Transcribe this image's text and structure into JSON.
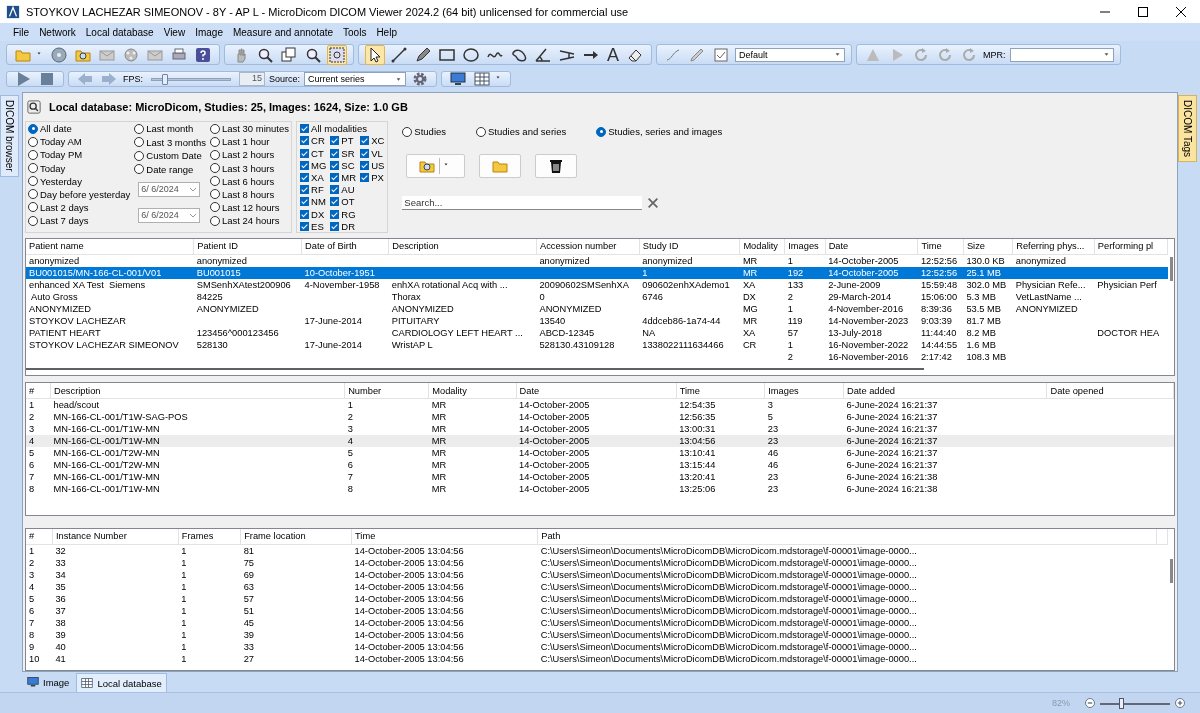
{
  "window": {
    "title": "STOYKOV LACHEZAR SIMEONOV - 8Y - AP L - MicroDicom DICOM Viewer 2024.2 (64 bit) unlicensed for commercial use"
  },
  "menu": [
    "File",
    "Network",
    "Local database",
    "View",
    "Image",
    "Measure and annotate",
    "Tools",
    "Help"
  ],
  "toolbar": {
    "text_tool": "A",
    "preset": "Default",
    "mpr_label": "MPR:",
    "fps": {
      "label": "FPS:",
      "level": 0.18,
      "value": "15"
    },
    "source": {
      "label": "Source:",
      "value": "Current series"
    }
  },
  "side_tabs": {
    "left": "DICOM browser",
    "right": "DICOM Tags"
  },
  "header": "Local database: MicroDicom, Studies: 25, Images: 1624, Size: 1.0 GB",
  "date_filters": [
    {
      "items": [
        {
          "kind": "radio",
          "label": "All date",
          "selected": true
        },
        {
          "kind": "radio",
          "label": "Today AM",
          "selected": false
        },
        {
          "kind": "radio",
          "label": "Today PM",
          "selected": false
        },
        {
          "kind": "radio",
          "label": "Today",
          "selected": false
        },
        {
          "kind": "radio",
          "label": "Yesterday",
          "selected": false
        },
        {
          "kind": "radio",
          "label": "Day before yesterday",
          "selected": false
        },
        {
          "kind": "radio",
          "label": "Last 2 days",
          "selected": false
        },
        {
          "kind": "radio",
          "label": "Last 7 days",
          "selected": false
        }
      ]
    },
    {
      "items": [
        {
          "kind": "radio",
          "label": "Last month",
          "selected": false
        },
        {
          "kind": "radio",
          "label": "Last 3 months",
          "selected": false
        },
        {
          "kind": "radio",
          "label": "Custom Date",
          "selected": false
        },
        {
          "kind": "radio",
          "label": "Date range",
          "selected": false
        },
        {
          "kind": "date",
          "value": "6/ 6/2024"
        },
        {
          "kind": "date",
          "value": "6/ 6/2024"
        }
      ]
    },
    {
      "items": [
        {
          "kind": "radio",
          "label": "Last 30 minutes",
          "selected": false
        },
        {
          "kind": "radio",
          "label": "Last 1 hour",
          "selected": false
        },
        {
          "kind": "radio",
          "label": "Last 2 hours",
          "selected": false
        },
        {
          "kind": "radio",
          "label": "Last 3 hours",
          "selected": false
        },
        {
          "kind": "radio",
          "label": "Last 6 hours",
          "selected": false
        },
        {
          "kind": "radio",
          "label": "Last 8 hours",
          "selected": false
        },
        {
          "kind": "radio",
          "label": "Last 12 hours",
          "selected": false
        },
        {
          "kind": "radio",
          "label": "Last 24 hours",
          "selected": false
        }
      ]
    }
  ],
  "modalities": {
    "all": {
      "label": "All modalities",
      "checked": true
    },
    "items": [
      {
        "label": "CR",
        "checked": true
      },
      {
        "label": "CT",
        "checked": true
      },
      {
        "label": "MG",
        "checked": true
      },
      {
        "label": "XA",
        "checked": true
      },
      {
        "label": "RF",
        "checked": true
      },
      {
        "label": "NM",
        "checked": true
      },
      {
        "label": "DX",
        "checked": true
      },
      {
        "label": "ES",
        "checked": true
      },
      {
        "label": "PT",
        "checked": true
      },
      {
        "label": "SR",
        "checked": true
      },
      {
        "label": "SC",
        "checked": true
      },
      {
        "label": "MR",
        "checked": true
      },
      {
        "label": "AU",
        "checked": true
      },
      {
        "label": "OT",
        "checked": true
      },
      {
        "label": "RG",
        "checked": true
      },
      {
        "label": "DR",
        "checked": true
      },
      {
        "label": "XC",
        "checked": true
      },
      {
        "label": "VL",
        "checked": true
      },
      {
        "label": "US",
        "checked": true
      },
      {
        "label": "PX",
        "checked": true
      }
    ]
  },
  "view_modes": [
    {
      "label": "Studies",
      "selected": false
    },
    {
      "label": "Studies and series",
      "selected": false
    },
    {
      "label": "Studies, series and images",
      "selected": true
    }
  ],
  "search": {
    "placeholder": "Search..."
  },
  "studies": {
    "columns": [
      "Patient name",
      "Patient ID",
      "Date of Birth",
      "Description",
      "Accession number",
      "Study ID",
      "Modality",
      "Images",
      "Date",
      "Time",
      "Size",
      "Referring phys...",
      "Performing pl"
    ],
    "rows": [
      {
        "selected": false,
        "cells": [
          "anonymized",
          "anonymized",
          null,
          null,
          "anonymized",
          "anonymized",
          "MR",
          "1",
          "14-October-2005",
          "12:52:56",
          "130.0 KB",
          "anonymized",
          null
        ]
      },
      {
        "selected": true,
        "cells": [
          "BU001015/MN-166-CL-001/V01",
          "BU001015",
          "10-October-1951",
          null,
          null,
          "1",
          "MR",
          "192",
          "14-October-2005",
          "12:52:56",
          "25.1 MB",
          null,
          null
        ]
      },
      {
        "selected": false,
        "cells": [
          "enhanced XA Test  Siemens",
          "SMSenhXAtest200906",
          "4-November-1958",
          "enhXA rotational Acq with ...",
          "20090602SMSenhXA",
          "090602enhXAdemo1",
          "XA",
          "133",
          "2-June-2009",
          "15:59:48",
          "302.0 MB",
          "Physician Refe...",
          "Physician Perf"
        ]
      },
      {
        "selected": false,
        "cells": [
          " Auto Gross",
          "84225",
          null,
          "Thorax",
          "0",
          "6746",
          "DX",
          "2",
          "29-March-2014",
          "15:06:00",
          "5.3 MB",
          "VetLastName ...",
          null
        ]
      },
      {
        "selected": false,
        "cells": [
          "ANONYMIZED",
          "ANONYMIZED",
          null,
          "ANONYMIZED",
          "ANONYMIZED",
          null,
          "MG",
          "1",
          "4-November-2016",
          "8:39:36",
          "53.5 MB",
          "ANONYMIZED",
          null
        ]
      },
      {
        "selected": false,
        "cells": [
          "STOYKOV LACHEZAR",
          null,
          "17-June-2014",
          "PITUITARY",
          "13540",
          "4ddceb86-1a74-44",
          "MR",
          "119",
          "14-November-2023",
          "9:03:39",
          "81.7 MB",
          null,
          null
        ]
      },
      {
        "selected": false,
        "cells": [
          "PATIENT HEART",
          "123456^000123456",
          null,
          "CARDIOLOGY LEFT HEART ...",
          "ABCD-12345",
          "NA",
          "XA",
          "57",
          "13-July-2018",
          "11:44:40",
          "8.2 MB",
          null,
          "DOCTOR HEA"
        ]
      },
      {
        "selected": false,
        "cells": [
          "STOYKOV LACHEZAR SIMEONOV",
          "528130",
          "17-June-2014",
          "WristAP L",
          "528130.43109128",
          "1338022111634466",
          "CR",
          "1",
          "16-November-2022",
          "14:44:55",
          "1.6 MB",
          null,
          null
        ]
      },
      {
        "selected": false,
        "cells": [
          null,
          null,
          null,
          null,
          null,
          null,
          null,
          "2",
          "16-November-2016",
          "2:17:42",
          "108.3 MB",
          null,
          null
        ]
      }
    ]
  },
  "series": {
    "columns": [
      "#",
      "Description",
      "Number",
      "Modality",
      "Date",
      "Time",
      "Images",
      "Date added",
      "Date opened"
    ],
    "rows": [
      {
        "selected": false,
        "cells": [
          "1",
          "head/scout",
          "1",
          "MR",
          "14-October-2005",
          "12:54:35",
          "3",
          "6-June-2024 16:21:37",
          null
        ]
      },
      {
        "selected": false,
        "cells": [
          "2",
          "MN-166-CL-001/T1W-SAG-POS",
          "2",
          "MR",
          "14-October-2005",
          "12:56:35",
          "5",
          "6-June-2024 16:21:37",
          null
        ]
      },
      {
        "selected": false,
        "cells": [
          "3",
          "MN-166-CL-001/T1W-MN",
          "3",
          "MR",
          "14-October-2005",
          "13:00:31",
          "23",
          "6-June-2024 16:21:37",
          null
        ]
      },
      {
        "selected": true,
        "cells": [
          "4",
          "MN-166-CL-001/T1W-MN",
          "4",
          "MR",
          "14-October-2005",
          "13:04:56",
          "23",
          "6-June-2024 16:21:37",
          null
        ]
      },
      {
        "selected": false,
        "cells": [
          "5",
          "MN-166-CL-001/T2W-MN",
          "5",
          "MR",
          "14-October-2005",
          "13:10:41",
          "46",
          "6-June-2024 16:21:37",
          null
        ]
      },
      {
        "selected": false,
        "cells": [
          "6",
          "MN-166-CL-001/T2W-MN",
          "6",
          "MR",
          "14-October-2005",
          "13:15:44",
          "46",
          "6-June-2024 16:21:37",
          null
        ]
      },
      {
        "selected": false,
        "cells": [
          "7",
          "MN-166-CL-001/T1W-MN",
          "7",
          "MR",
          "14-October-2005",
          "13:20:41",
          "23",
          "6-June-2024 16:21:38",
          null
        ]
      },
      {
        "selected": false,
        "cells": [
          "8",
          "MN-166-CL-001/T1W-MN",
          "8",
          "MR",
          "14-October-2005",
          "13:25:06",
          "23",
          "6-June-2024 16:21:38",
          null
        ]
      }
    ]
  },
  "instances": {
    "columns": [
      "#",
      "Instance Number",
      "Frames",
      "Frame location",
      "Time",
      "Path"
    ],
    "rows": [
      {
        "cells": [
          "1",
          "32",
          "1",
          "81",
          "14-October-2005 13:04:56",
          "C:\\Users\\Simeon\\Documents\\MicroDicomDB\\MicroDicom.mdstorage\\f-00001\\image-0000..."
        ]
      },
      {
        "cells": [
          "2",
          "33",
          "1",
          "75",
          "14-October-2005 13:04:56",
          "C:\\Users\\Simeon\\Documents\\MicroDicomDB\\MicroDicom.mdstorage\\f-00001\\image-0000..."
        ]
      },
      {
        "cells": [
          "3",
          "34",
          "1",
          "69",
          "14-October-2005 13:04:56",
          "C:\\Users\\Simeon\\Documents\\MicroDicomDB\\MicroDicom.mdstorage\\f-00001\\image-0000..."
        ]
      },
      {
        "cells": [
          "4",
          "35",
          "1",
          "63",
          "14-October-2005 13:04:56",
          "C:\\Users\\Simeon\\Documents\\MicroDicomDB\\MicroDicom.mdstorage\\f-00001\\image-0000..."
        ]
      },
      {
        "cells": [
          "5",
          "36",
          "1",
          "57",
          "14-October-2005 13:04:56",
          "C:\\Users\\Simeon\\Documents\\MicroDicomDB\\MicroDicom.mdstorage\\f-00001\\image-0000..."
        ]
      },
      {
        "cells": [
          "6",
          "37",
          "1",
          "51",
          "14-October-2005 13:04:56",
          "C:\\Users\\Simeon\\Documents\\MicroDicomDB\\MicroDicom.mdstorage\\f-00001\\image-0000..."
        ]
      },
      {
        "cells": [
          "7",
          "38",
          "1",
          "45",
          "14-October-2005 13:04:56",
          "C:\\Users\\Simeon\\Documents\\MicroDicomDB\\MicroDicom.mdstorage\\f-00001\\image-0000..."
        ]
      },
      {
        "cells": [
          "8",
          "39",
          "1",
          "39",
          "14-October-2005 13:04:56",
          "C:\\Users\\Simeon\\Documents\\MicroDicomDB\\MicroDicom.mdstorage\\f-00001\\image-0000..."
        ]
      },
      {
        "cells": [
          "9",
          "40",
          "1",
          "33",
          "14-October-2005 13:04:56",
          "C:\\Users\\Simeon\\Documents\\MicroDicomDB\\MicroDicom.mdstorage\\f-00001\\image-0000..."
        ]
      },
      {
        "cells": [
          "10",
          "41",
          "1",
          "27",
          "14-October-2005 13:04:56",
          "C:\\Users\\Simeon\\Documents\\MicroDicomDB\\MicroDicom.mdstorage\\f-00001\\image-0000..."
        ]
      }
    ]
  },
  "bottom_tabs": [
    {
      "label": "Image",
      "selected": false
    },
    {
      "label": "Local database",
      "selected": true
    }
  ],
  "status_bar": {
    "zoom": {
      "value": "82%",
      "level": 0.3
    }
  }
}
